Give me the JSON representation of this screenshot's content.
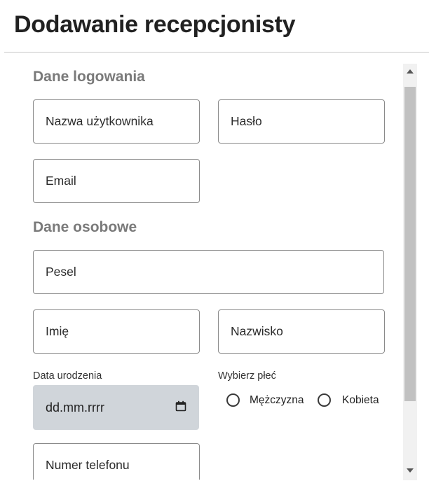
{
  "page": {
    "title": "Dodawanie recepcjonisty"
  },
  "sections": {
    "login": {
      "heading": "Dane logowania",
      "username_placeholder": "Nazwa użytkownika",
      "password_placeholder": "Hasło",
      "email_placeholder": "Email"
    },
    "personal": {
      "heading": "Dane osobowe",
      "pesel_placeholder": "Pesel",
      "first_name_placeholder": "Imię",
      "last_name_placeholder": "Nazwisko",
      "birth_date_label": "Data urodzenia",
      "birth_date_placeholder": "dd.mm.rrrr",
      "gender_label": "Wybierz płeć",
      "gender_options": [
        "Mężczyzna",
        "Kobieta"
      ],
      "phone_placeholder": "Numer telefonu"
    }
  },
  "icons": {
    "date": "calendar-icon",
    "scroll_up": "scroll-up-arrow-icon",
    "scroll_down": "scroll-down-arrow-icon"
  },
  "colors": {
    "date_field_bg": "#d0d5da",
    "section_heading": "#7a7a7a",
    "scroll_thumb": "#c1c1c1"
  }
}
